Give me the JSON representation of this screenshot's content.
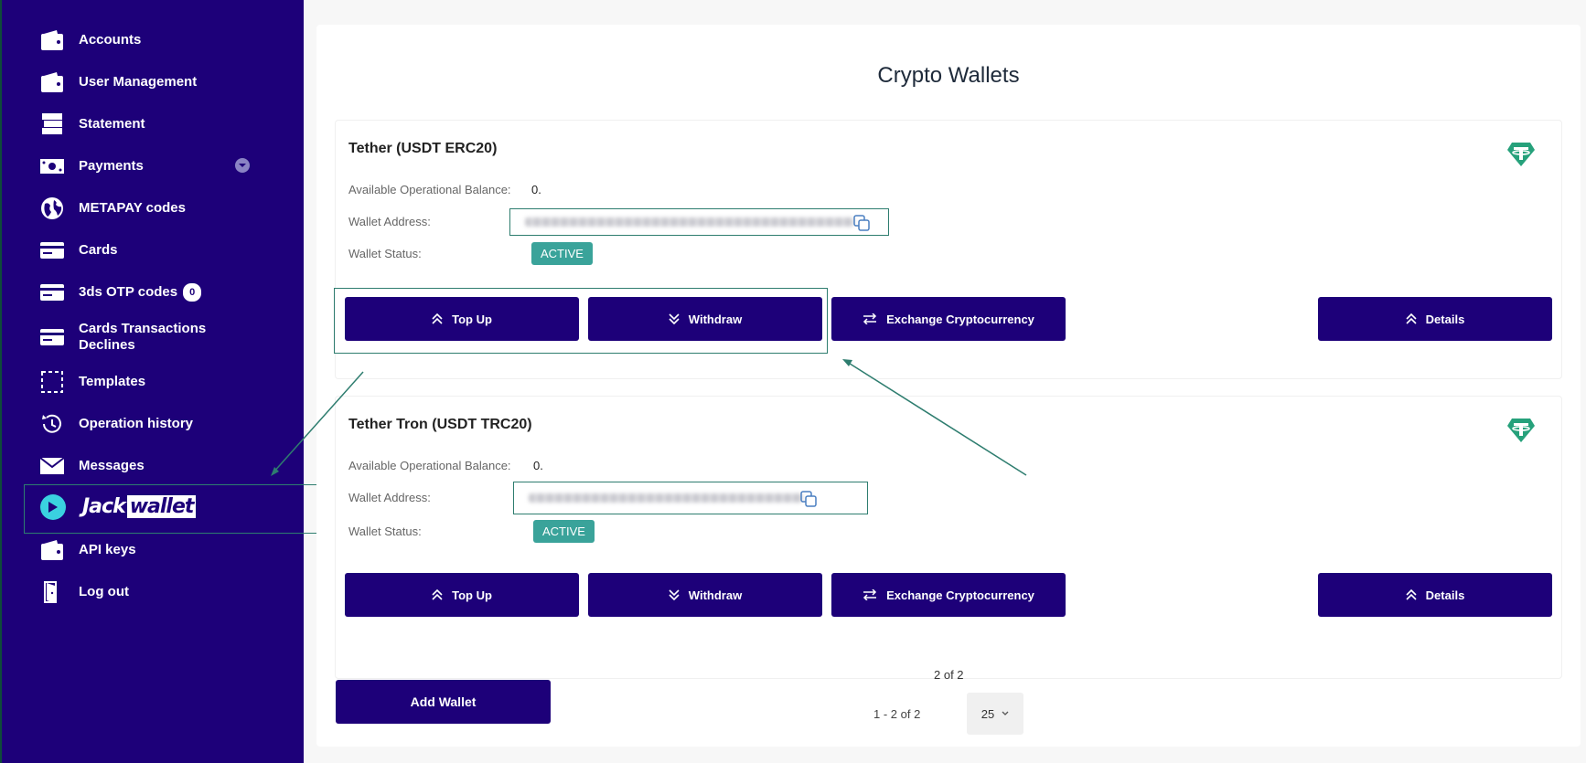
{
  "sidebar": {
    "items": [
      {
        "label": "Accounts"
      },
      {
        "label": "User Management"
      },
      {
        "label": "Statement"
      },
      {
        "label": "Payments"
      },
      {
        "label": "METAPAY codes"
      },
      {
        "label": "Cards"
      },
      {
        "label": "3ds OTP codes",
        "badge": "0"
      },
      {
        "label": "Cards Transactions Declines"
      },
      {
        "label": "Templates"
      },
      {
        "label": "Operation history"
      },
      {
        "label": "Messages"
      },
      {
        "label": "API keys"
      },
      {
        "label": "Log out"
      }
    ],
    "brand": {
      "prefix": "Jack",
      "suffix": "wallet"
    }
  },
  "page": {
    "title": "Crypto Wallets"
  },
  "wallets": [
    {
      "name": "Tether (USDT ERC20)",
      "balance_label": "Available Operational Balance:",
      "balance_value": "0.",
      "address_label": "Wallet Address:",
      "status_label": "Wallet Status:",
      "status": "ACTIVE"
    },
    {
      "name": "Tether Tron (USDT TRC20)",
      "balance_label": "Available Operational Balance:",
      "balance_value": "0.",
      "address_label": "Wallet Address:",
      "status_label": "Wallet Status:",
      "status": "ACTIVE"
    }
  ],
  "actions": {
    "top_up": "Top Up",
    "withdraw": "Withdraw",
    "exchange": "Exchange Cryptocurrency",
    "details": "Details",
    "add_wallet": "Add Wallet"
  },
  "pagination": {
    "page": "2 of 2",
    "range": "1 - 2 of 2",
    "per_page": "25"
  },
  "colors": {
    "primary": "#1d0079",
    "status": "#3aa39a",
    "highlight": "#2e7d6f",
    "tether": "#26a17b"
  }
}
